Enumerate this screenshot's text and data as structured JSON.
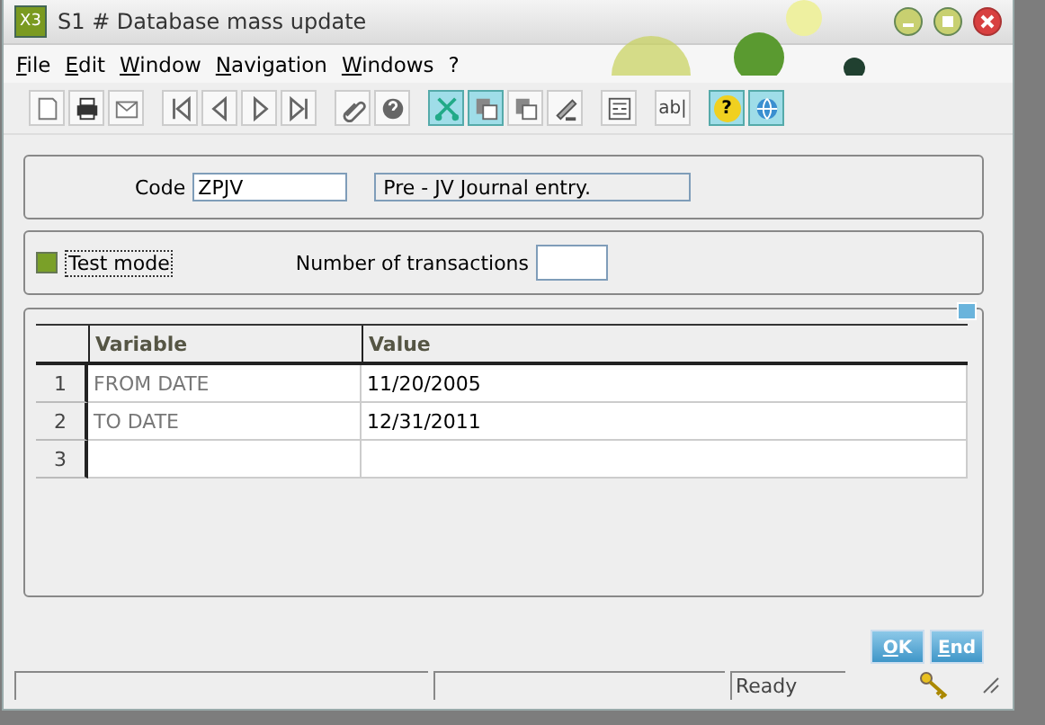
{
  "window": {
    "title": "S1 # Database mass update",
    "logo": "X3"
  },
  "menu": [
    {
      "label": "File"
    },
    {
      "label": "Edit"
    },
    {
      "label": "Window"
    },
    {
      "label": "Navigation"
    },
    {
      "label": "Windows"
    },
    {
      "label": "?"
    }
  ],
  "toolbar": [
    [
      {
        "kind": "page",
        "active": false
      },
      {
        "kind": "print",
        "active": false
      },
      {
        "kind": "mail",
        "active": false
      }
    ],
    [
      {
        "kind": "first",
        "active": false
      },
      {
        "kind": "prev",
        "active": false
      },
      {
        "kind": "next",
        "active": false
      },
      {
        "kind": "last",
        "active": false
      }
    ],
    [
      {
        "kind": "clip",
        "active": false
      },
      {
        "kind": "help",
        "active": false
      }
    ],
    [
      {
        "kind": "scissors",
        "active": true
      },
      {
        "kind": "copy",
        "active": true
      },
      {
        "kind": "copy",
        "active": false
      },
      {
        "kind": "pen",
        "active": false
      }
    ],
    [
      {
        "kind": "form",
        "active": false
      }
    ],
    [
      {
        "kind": "text",
        "label": "ab|",
        "active": false
      }
    ],
    [
      {
        "kind": "question",
        "label": "?",
        "active": true
      },
      {
        "kind": "globe",
        "active": true
      }
    ]
  ],
  "code": {
    "label": "Code",
    "value": "ZPJV",
    "description": "Pre - JV Journal entry."
  },
  "test_mode": {
    "label": "Test mode",
    "checked": true
  },
  "transactions": {
    "label": "Number of transactions"
  },
  "table": {
    "columns": [
      "Variable",
      "Value"
    ],
    "rows": [
      {
        "number": "1",
        "variable": "FROM DATE",
        "value": "11/20/2005"
      },
      {
        "number": "2",
        "variable": "TO DATE",
        "value": "12/31/2011"
      },
      {
        "number": "3"
      }
    ]
  },
  "buttons": [
    {
      "label": "OK"
    },
    {
      "label": "End"
    }
  ],
  "status_bar": {
    "status": "Ready"
  }
}
